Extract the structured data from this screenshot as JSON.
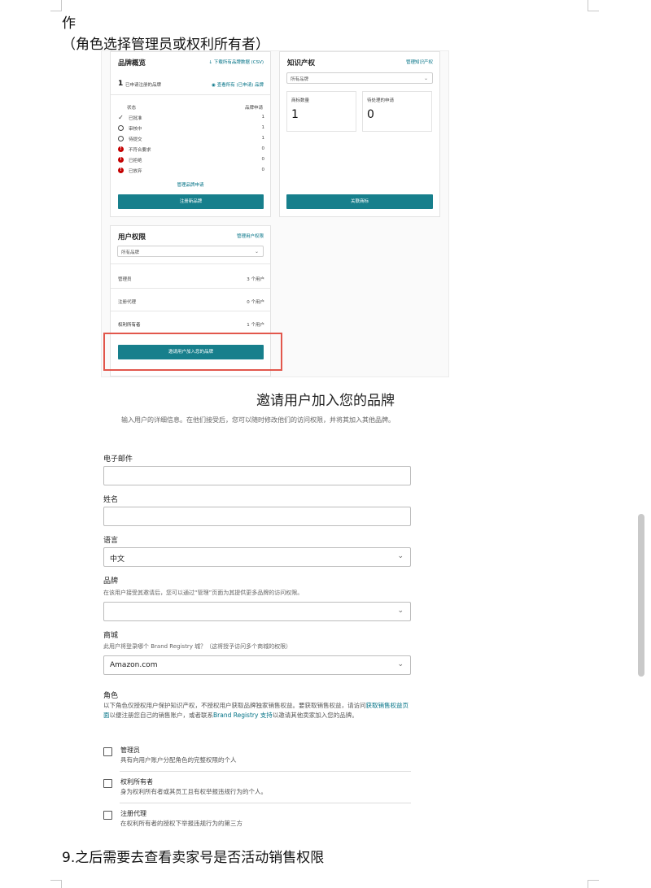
{
  "doc": {
    "line1": "作",
    "line2": "（角色选择管理员或权利所有者）",
    "line9": "9.之后需要去查看卖家号是否活动销售权限"
  },
  "brand_card": {
    "title": "品牌概览",
    "download_link": "↓ 下载所有品牌数据 (CSV)",
    "count": "1",
    "count_label": "已申请注册的品牌",
    "view_link": "查看所有 (已申请) 品牌",
    "col_status": "状态",
    "col_count": "品牌申请",
    "statuses": [
      {
        "label": "已批准",
        "count": "1",
        "icon": "check-icon"
      },
      {
        "label": "审核中",
        "count": "1",
        "icon": "clock-icon"
      },
      {
        "label": "待提交",
        "count": "1",
        "icon": "clock-icon"
      },
      {
        "label": "不符合要求",
        "count": "0",
        "icon": "alert-icon"
      },
      {
        "label": "已拒绝",
        "count": "0",
        "icon": "alert-icon"
      },
      {
        "label": "已放弃",
        "count": "0",
        "icon": "alert-icon"
      }
    ],
    "manage_link": "管理品牌申请",
    "register_button": "注册新品牌"
  },
  "ip_card": {
    "title": "知识产权",
    "manage_link": "管理知识产权",
    "select_value": "所有品牌",
    "box1_label": "商标数量",
    "box1_value": "1",
    "box2_label": "待处理的申请",
    "box2_value": "0",
    "button": "关联商标"
  },
  "user_card": {
    "title": "用户权限",
    "manage_link": "管理用户权限",
    "select_value": "所有品牌",
    "roles": [
      {
        "label": "管理员",
        "value": "3 个用户"
      },
      {
        "label": "注册代理",
        "value": "0 个用户"
      },
      {
        "label": "权利所有者",
        "value": "1 个用户"
      }
    ],
    "invite_button": "邀请用户加入您的品牌"
  },
  "form": {
    "title": "邀请用户加入您的品牌",
    "description": "输入用户的详细信息。在他们接受后，您可以随时修改他们的访问权限，并将其加入其他品牌。",
    "email_label": "电子邮件",
    "email_value": "",
    "name_label": "姓名",
    "name_value": "",
    "language_label": "语言",
    "language_value": "中文",
    "brand_label": "品牌",
    "brand_help": "在该用户接受其邀请后，您可以通过“管理”页面为其提供更多品牌的访问权限。",
    "brand_value": "",
    "marketplace_label": "商城",
    "marketplace_help": "此用户将登录哪个 Brand Registry 城？（这将授予访问多个商城的权限）",
    "marketplace_value": "Amazon.com",
    "role_label": "角色",
    "role_desc_1": "以下角色仅授权用户保护知识产权，不授权用户获取品牌独家销售权益。要获取销售权益，请访问",
    "role_desc_link_1": "获取销售权益页面",
    "role_desc_2": "以便注册您自己的销售账户，或者联系",
    "role_desc_link_2": "Brand Registry 支持",
    "role_desc_3": "以邀请其他卖家加入您的品牌。",
    "roles": [
      {
        "title": "管理员",
        "desc": "具有向用户账户分配角色的完整权限的个人"
      },
      {
        "title": "权利所有者",
        "desc": "身为权利所有者或其员工且有权举报违规行为的个人。"
      },
      {
        "title": "注册代理",
        "desc": "在权利所有者的授权下举报违规行为的第三方"
      }
    ]
  }
}
